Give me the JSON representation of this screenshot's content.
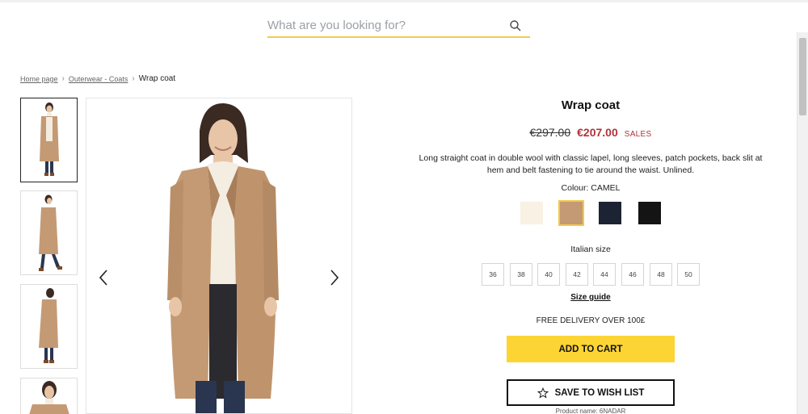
{
  "search": {
    "placeholder": "What are you looking for?",
    "value": ""
  },
  "breadcrumb": {
    "items": [
      "Home page",
      "Outerwear - Coats"
    ],
    "separator": "›",
    "current": "Wrap coat"
  },
  "gallery": {
    "thumbnails": [
      "coat-front-view",
      "coat-walking-view",
      "coat-side-view",
      "coat-detail-view"
    ],
    "main_image": "coat-front-view"
  },
  "product": {
    "title": "Wrap coat",
    "old_price": "€297.00",
    "new_price": "€207.00",
    "sales_label": "SALES",
    "description": "Long straight coat in double wool with classic lapel, long sleeves, patch pockets, back slit at hem and belt fastening to tie around the waist. Unlined.",
    "colour_label": "Colour: CAMEL",
    "colours": [
      {
        "name": "cream",
        "hex": "#f8f1e4"
      },
      {
        "name": "camel",
        "hex": "#c49a74",
        "selected": true
      },
      {
        "name": "navy",
        "hex": "#1c2333"
      },
      {
        "name": "black",
        "hex": "#141414"
      }
    ],
    "size_label": "Italian size",
    "sizes": [
      "36",
      "38",
      "40",
      "42",
      "44",
      "46",
      "48",
      "50"
    ],
    "size_guide": "Size guide",
    "delivery": "FREE DELIVERY OVER 100£",
    "add_to_cart": "ADD TO CART",
    "wishlist": "SAVE TO WISH LIST",
    "product_name": "Product name: 6NADAR"
  },
  "colors": {
    "accent": "#fcd535",
    "sale": "#b0323a",
    "search_underline": "#f2c94c"
  }
}
